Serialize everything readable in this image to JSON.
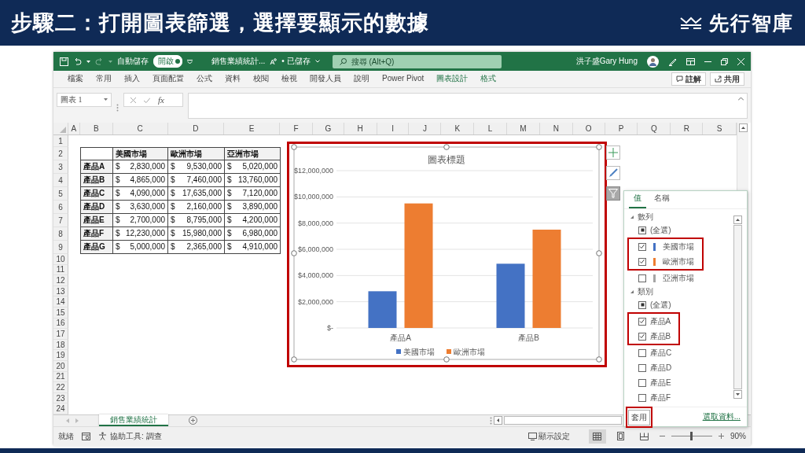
{
  "slide": {
    "title": "步驟二：打開圖表篩選，選擇要顯示的數據",
    "brand": "先行智庫"
  },
  "excel": {
    "titlebar": {
      "autosave_label": "自動儲存",
      "autosave_toggle": {
        "label": "開啟",
        "on": true
      },
      "filename": "銷售業績統計...",
      "save_status": "• 已儲存",
      "search": {
        "placeholder": "搜尋 (Alt+Q)"
      },
      "user": "洪子盛Gary Hung"
    },
    "ribbon_tabs": [
      {
        "label": "檔案",
        "contextual": false
      },
      {
        "label": "常用",
        "contextual": false
      },
      {
        "label": "插入",
        "contextual": false
      },
      {
        "label": "頁面配置",
        "contextual": false
      },
      {
        "label": "公式",
        "contextual": false
      },
      {
        "label": "資料",
        "contextual": false
      },
      {
        "label": "校閱",
        "contextual": false
      },
      {
        "label": "檢視",
        "contextual": false
      },
      {
        "label": "開發人員",
        "contextual": false
      },
      {
        "label": "說明",
        "contextual": false
      },
      {
        "label": "Power Pivot",
        "contextual": false
      },
      {
        "label": "圖表設計",
        "contextual": true
      },
      {
        "label": "格式",
        "contextual": true
      }
    ],
    "ribbon_buttons": [
      "註解",
      "共用"
    ],
    "formula_bar": {
      "name_box": "圖表 1",
      "fx": "fx"
    },
    "columns": [
      "A",
      "B",
      "C",
      "D",
      "E",
      "F",
      "G",
      "H",
      "I",
      "J",
      "K",
      "L",
      "M",
      "N",
      "O",
      "P",
      "Q",
      "R",
      "S"
    ],
    "rows": [
      "1",
      "2",
      "3",
      "4",
      "5",
      "6",
      "7",
      "8",
      "9",
      "10",
      "11",
      "12",
      "13",
      "14",
      "15",
      "16",
      "17",
      "18",
      "19",
      "20",
      "21",
      "22",
      "23",
      "24"
    ],
    "table": {
      "columns": [
        "美國市場",
        "歐洲市場",
        "亞洲市場"
      ],
      "rows": [
        {
          "label": "產品A",
          "cells": [
            "$ 2,830,000",
            "$ 9,530,000",
            "$ 5,020,000"
          ]
        },
        {
          "label": "產品B",
          "cells": [
            "$ 4,865,000",
            "$ 7,460,000",
            "$ 13,760,000"
          ]
        },
        {
          "label": "產品C",
          "cells": [
            "$ 4,090,000",
            "$ 17,635,000",
            "$ 7,120,000"
          ]
        },
        {
          "label": "產品D",
          "cells": [
            "$ 3,630,000",
            "$ 2,160,000",
            "$ 3,890,000"
          ]
        },
        {
          "label": "產品E",
          "cells": [
            "$ 2,700,000",
            "$ 8,795,000",
            "$ 4,200,000"
          ]
        },
        {
          "label": "產品F",
          "cells": [
            "$ 12,230,000",
            "$ 15,980,000",
            "$ 6,980,000"
          ]
        },
        {
          "label": "產品G",
          "cells": [
            "$ 5,000,000",
            "$ 2,365,000",
            "$ 4,910,000"
          ]
        }
      ]
    },
    "chart": {
      "highlighted": true,
      "chart_data": {
        "type": "bar",
        "title": "圖表標題",
        "categories": [
          "產品A",
          "產品B"
        ],
        "series": [
          {
            "name": "美國市場",
            "color": "#4472c4",
            "values": [
              2800000,
              4900000
            ]
          },
          {
            "name": "歐洲市場",
            "color": "#ed7d31",
            "values": [
              9500000,
              7500000
            ]
          }
        ],
        "grid": true,
        "legend": "bottom",
        "ylim": [
          0,
          12000000
        ],
        "yticks": [
          {
            "value": 0,
            "label": "$-"
          },
          {
            "value": 2000000,
            "label": "$2,000,000"
          },
          {
            "value": 4000000,
            "label": "$4,000,000"
          },
          {
            "value": 6000000,
            "label": "$6,000,000"
          },
          {
            "value": 8000000,
            "label": "$8,000,000"
          },
          {
            "value": 10000000,
            "label": "$10,000,000"
          },
          {
            "value": 12000000,
            "label": "$12,000,000"
          }
        ]
      }
    },
    "filter_panel": {
      "tabs": [
        {
          "label": "值",
          "selected": true
        },
        {
          "label": "名稱",
          "selected": false
        }
      ],
      "groups": [
        {
          "label": "數列",
          "items": [
            {
              "kind": "select-all",
              "label": "(全選)",
              "indeterminate": true,
              "highlighted": false
            },
            {
              "kind": "option",
              "label": "美國市場",
              "checked": true,
              "color": "#4472c4",
              "highlighted": true
            },
            {
              "kind": "option",
              "label": "歐洲市場",
              "checked": true,
              "color": "#ed7d31",
              "highlighted": true
            },
            {
              "kind": "option",
              "label": "亞洲市場",
              "checked": false,
              "color": "#a5a5a5",
              "highlighted": false
            }
          ]
        },
        {
          "label": "類別",
          "items": [
            {
              "kind": "select-all",
              "label": "(全選)",
              "indeterminate": true,
              "highlighted": false
            },
            {
              "kind": "option",
              "label": "產品A",
              "checked": true,
              "highlighted": true
            },
            {
              "kind": "option",
              "label": "產品B",
              "checked": true,
              "highlighted": true
            },
            {
              "kind": "option",
              "label": "產品C",
              "checked": false,
              "highlighted": false
            },
            {
              "kind": "option",
              "label": "產品D",
              "checked": false,
              "highlighted": false
            },
            {
              "kind": "option",
              "label": "產品E",
              "checked": false,
              "highlighted": false
            },
            {
              "kind": "option",
              "label": "產品F",
              "checked": false,
              "highlighted": false
            }
          ]
        }
      ],
      "apply": {
        "label": "套用",
        "highlighted": true
      },
      "link": "選取資料..."
    },
    "sheet_tabs": [
      {
        "label": "銷售業績統計",
        "selected": true
      }
    ],
    "status_bar": {
      "ready": "就緒",
      "accessibility": "協助工具: 調查",
      "display_settings": "顯示設定",
      "zoom": {
        "level": 0.48,
        "reading": "90%"
      }
    }
  }
}
